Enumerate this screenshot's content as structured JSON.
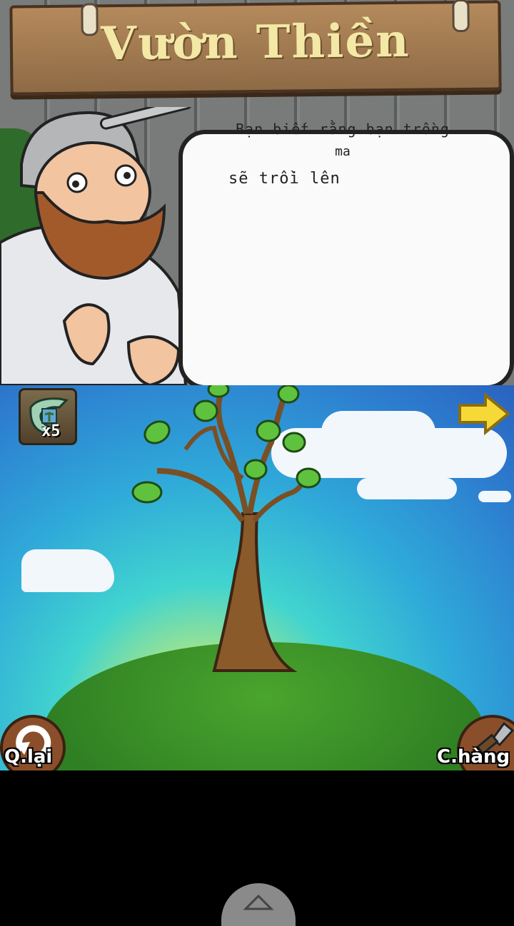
{
  "header": {
    "title": "Vườn Thiền"
  },
  "dialog": {
    "line1": "Bạn biết rằng bạn trồng",
    "line2": "ma",
    "line3": "sẽ trồi lên"
  },
  "hud": {
    "seed_count": "x5",
    "back_label": "Q.lại",
    "shop_label": "C.hàng"
  },
  "icons": {
    "next": "arrow-right-icon",
    "back": "back-circle-icon",
    "shop": "shovel-icon",
    "seed": "seed-packet-icon",
    "nav": "chevron-up-icon"
  }
}
